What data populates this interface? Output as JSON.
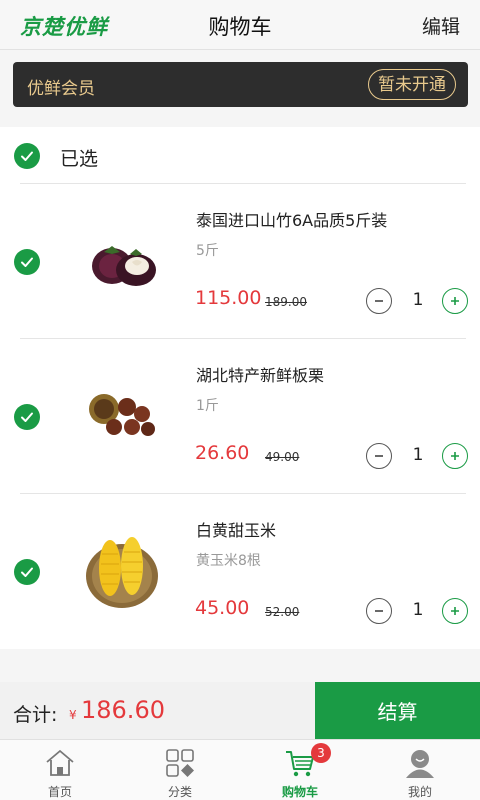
{
  "header": {
    "logo": "京楚优鲜",
    "title": "购物车",
    "edit_label": "编辑"
  },
  "member": {
    "label": "优鲜会员",
    "button": "暂未开通"
  },
  "cart": {
    "select_label": "已选",
    "items": [
      {
        "name": "泰国进口山竹6A品质5斤装",
        "spec": "5斤",
        "price": "115.00",
        "original_price": "189.00",
        "quantity": "1",
        "image": "mangosteen-image",
        "checked": true
      },
      {
        "name": "湖北特产新鲜板栗",
        "spec": "1斤",
        "price": "26.60",
        "original_price": "49.00",
        "quantity": "1",
        "image": "chestnut-image",
        "checked": true
      },
      {
        "name": "白黄甜玉米",
        "spec": "黄玉米8根",
        "price": "45.00",
        "original_price": "52.00",
        "quantity": "1",
        "image": "corn-image",
        "checked": true
      }
    ]
  },
  "footer": {
    "total_label": "合计:",
    "currency": "¥",
    "total": "186.60",
    "checkout_label": "结算"
  },
  "tabs": [
    {
      "label": "首页",
      "icon": "home-icon",
      "active": false
    },
    {
      "label": "分类",
      "icon": "category-icon",
      "active": false
    },
    {
      "label": "购物车",
      "icon": "cart-icon",
      "active": true,
      "badge": "3"
    },
    {
      "label": "我的",
      "icon": "profile-icon",
      "active": false
    }
  ],
  "colors": {
    "brand_green": "#1a9b45",
    "price_red": "#e4393c",
    "member_gold": "#e8c98d",
    "member_bg": "#2d2d2d"
  }
}
